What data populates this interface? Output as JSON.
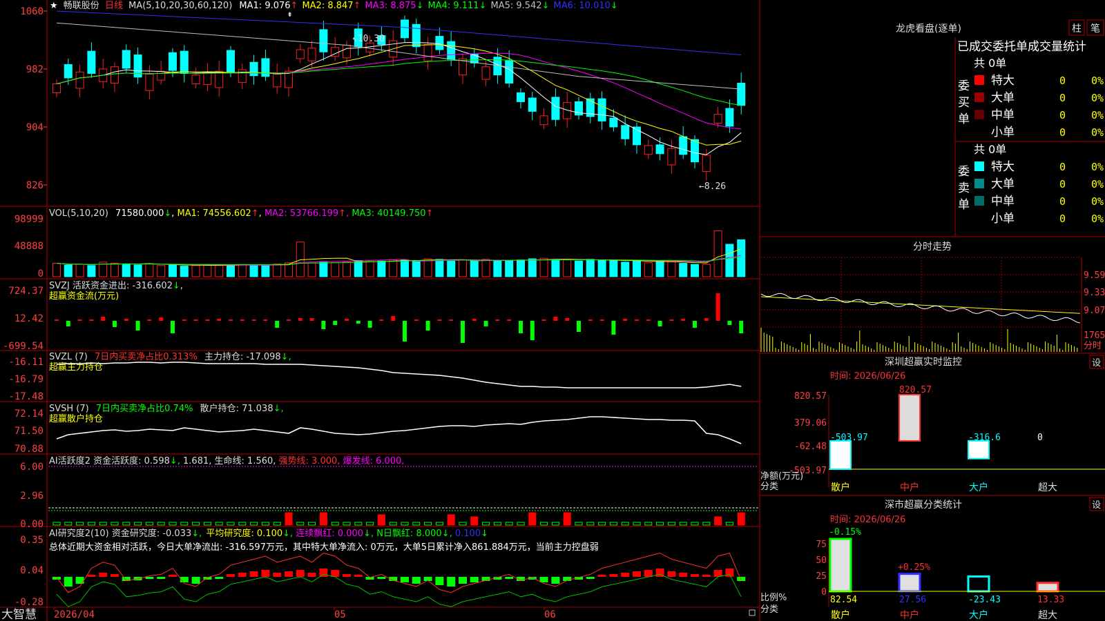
{
  "header": {
    "star": "★",
    "stock_name": "畅联股份",
    "period": "日线",
    "ma_label": "MA(5,10,20,30,60,120)",
    "ma_values": [
      {
        "label": "MA1:",
        "value": "9.076",
        "arrow": "↑",
        "color": "#ffffff"
      },
      {
        "label": "MA2:",
        "value": "8.847",
        "arrow": "↑",
        "color": "#ffff00"
      },
      {
        "label": "MA3:",
        "value": "8.875",
        "arrow": "↓",
        "color": "#ff00ff"
      },
      {
        "label": "MA4:",
        "value": "9.111",
        "arrow": "↓",
        "color": "#00ff00"
      },
      {
        "label": "MA5:",
        "value": "9.542",
        "arrow": "↓",
        "color": "#c0c0c0"
      },
      {
        "label": "MA6:",
        "value": "10.010",
        "arrow": "↓",
        "color": "#3030ff"
      }
    ]
  },
  "price_axis": {
    "ticks": [
      "1060",
      "982",
      "904",
      "826"
    ]
  },
  "price_annotations": {
    "high": "10.30",
    "low": "8.26"
  },
  "vol_panel": {
    "title": "VOL(5,10,20)",
    "value": "71580.000",
    "value_arrow": "↓",
    "ma1": "MA1: 74556.602",
    "ma1_arrow": "↑",
    "ma2": "MA2: 53766.199",
    "ma2_arrow": "↑",
    "ma3": "MA3: 40149.750",
    "ma3_arrow": "↑",
    "ticks": [
      "98999",
      "48888",
      "0"
    ]
  },
  "svzj_panel": {
    "title": "SVZJ  活跃资金进出: -316.602",
    "title_arrow": "↓",
    "subtitle": "超赢资金流(万元)",
    "ticks": [
      "724.37",
      "12.42",
      "-699.54"
    ]
  },
  "svzl_panel": {
    "title": "SVZL (7)",
    "ratio": "7日内买卖净占比0.313%",
    "hold": "主力持仓: -17.098",
    "hold_arrow": "↓,",
    "subtitle": "超赢主力持仓",
    "ticks": [
      "-16.11",
      "-16.79",
      "-17.48"
    ]
  },
  "svsh_panel": {
    "title": "SVSH (7)",
    "ratio": "7日内买卖净占比0.74%",
    "hold": "散户持仓: 71.038",
    "hold_arrow": "↓,",
    "subtitle": "超赢散户持仓",
    "ticks": [
      "72.14",
      "71.50",
      "70.88"
    ]
  },
  "ai_active_panel": {
    "title": "AI活跃度2 资金活跃度: 0.598",
    "arrow1": "↓,",
    "v2": "1.681,",
    "life": "生命线: 1.560,",
    "strong": "强势线: 3.000,",
    "burst": "爆发线: 6.000,",
    "ticks": [
      "6.00",
      "2.96",
      "0.00"
    ]
  },
  "ai_research_panel": {
    "title": "AI研究度2(10) 资金研究度: -0.033",
    "arrow1": "↓,",
    "avg": "平均研究度: 0.100",
    "avg_arrow": "↓,",
    "red": "连续飘红: 0.000",
    "red_arrow": "↓,",
    "nred": "N日飘红: 8.000",
    "nred_arrow": "↓,",
    "last": "0.100",
    "last_arrow": "↓",
    "summary": "总体近期大资金相对活跃，今日大单净流出: -316.597万元，其中特大单净流入: 0万元，大单5日累计净入861.884万元，当前主力控盘弱",
    "ticks": [
      "0.35",
      "0.04",
      "-0.28"
    ]
  },
  "date_axis": {
    "start": "2026/04",
    "m05": "05",
    "m06": "06"
  },
  "brand": "大智慧",
  "right_panel": {
    "title": "龙虎看盘(逐单)",
    "btn_zhu": "柱",
    "btn_bi": "笔",
    "subtitle": "已成交委托单成交量统计",
    "buy_label": "委买单",
    "sell_label": "委卖单",
    "buy_total": "共 0单",
    "sell_total": "共 0单",
    "buy_rows": [
      {
        "name": "特大",
        "count": "0",
        "pct": "0%",
        "color": "#ff0000"
      },
      {
        "name": "大单",
        "count": "0",
        "pct": "0%",
        "color": "#990000"
      },
      {
        "name": "中单",
        "count": "0",
        "pct": "0%",
        "color": "#660000"
      },
      {
        "name": "小单",
        "count": "0",
        "pct": "0%",
        "color": "#000000"
      }
    ],
    "sell_rows": [
      {
        "name": "特大",
        "count": "0",
        "pct": "0%",
        "color": "#00ffff"
      },
      {
        "name": "大单",
        "count": "0",
        "pct": "0%",
        "color": "#008b8b"
      },
      {
        "name": "中单",
        "count": "0",
        "pct": "0%",
        "color": "#006b6b"
      },
      {
        "name": "小单",
        "count": "0",
        "pct": "0%",
        "color": "#000000"
      }
    ],
    "intraday_title": "分时走势",
    "intraday_ticks": [
      "9.59",
      "9.33",
      "9.07",
      "1765",
      "分时"
    ],
    "sz_monitor_title": "深圳超赢实时监控",
    "sz_set": "设",
    "sz_time": "时间: 2026/06/26",
    "sz_ticks": [
      "820.57",
      "379.06",
      "-62.48",
      "-503.97"
    ],
    "sz_values": [
      "-503.97",
      "820.57",
      "-316.6",
      "0"
    ],
    "sz_net_label": "净额(万元)",
    "sz_cat_label": "分类",
    "sz_cats": [
      "散户",
      "中户",
      "大户",
      "超大"
    ],
    "cls_title": "深市超赢分类统计",
    "cls_set": "设",
    "cls_time": "时间: 2026/06/26",
    "cls_ticks": [
      "75",
      "50",
      "25",
      "0"
    ],
    "cls_pct_a": "-0.15%",
    "cls_pct_b": "+0.25%",
    "cls_values": [
      "82.54",
      "27.56",
      "-23.43",
      "13.33"
    ],
    "cls_ratio_label": "比例%",
    "cls_cat_label": "分类",
    "cls_cats": [
      "散户",
      "中户",
      "大户",
      "超大"
    ]
  },
  "colors": {
    "up": "#ff2020",
    "down": "#00ffff",
    "frame": "#b00000",
    "axis": "#ff4040"
  }
}
